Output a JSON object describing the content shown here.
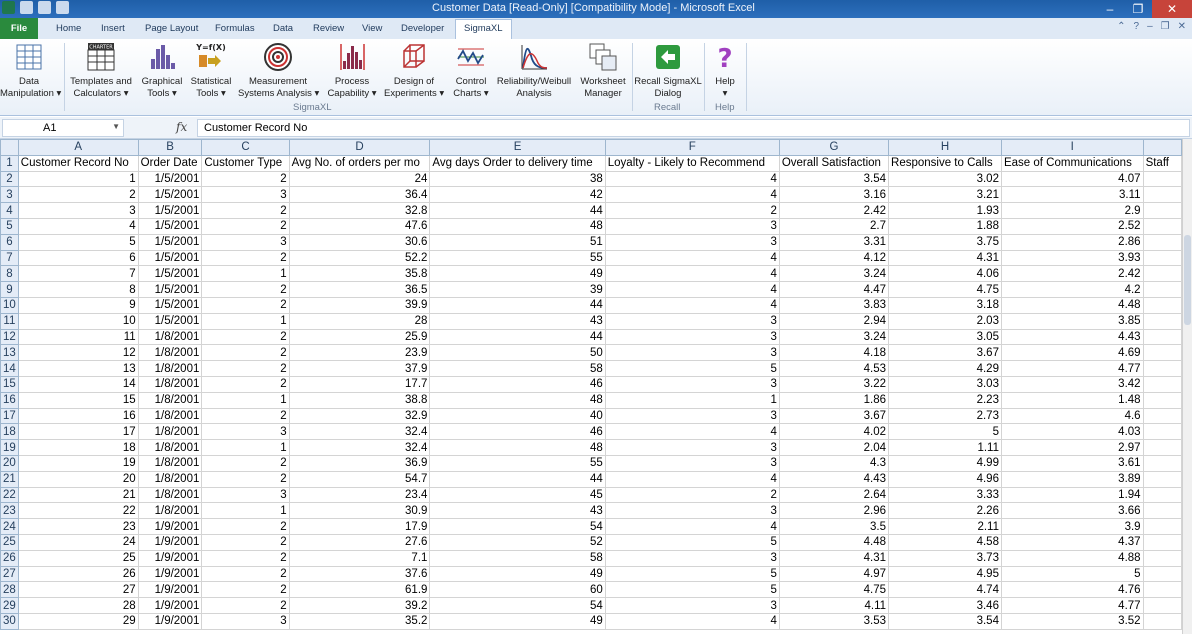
{
  "window": {
    "title": "Customer Data  [Read-Only]  [Compatibility Mode]  -  Microsoft Excel",
    "controls": [
      "–",
      "❐",
      "✕"
    ]
  },
  "ribbon_tabs": {
    "file": "File",
    "tabs": [
      "Home",
      "Insert",
      "Page Layout",
      "Formulas",
      "Data",
      "Review",
      "View",
      "Developer",
      "SigmaXL"
    ],
    "active": "SigmaXL"
  },
  "ribbon": {
    "buttons": [
      {
        "line1": "Data",
        "line2": "Manipulation ▾",
        "icon": "data-manipulation-icon"
      },
      {
        "line1": "Templates and",
        "line2": "Calculators ▾",
        "icon": "templates-icon"
      },
      {
        "line1": "Graphical",
        "line2": "Tools ▾",
        "icon": "graphical-tools-icon"
      },
      {
        "line1": "Statistical",
        "line2": "Tools ▾",
        "icon": "statistical-tools-icon"
      },
      {
        "line1": "Measurement",
        "line2": "Systems Analysis ▾",
        "icon": "target-icon"
      },
      {
        "line1": "Process",
        "line2": "Capability ▾",
        "icon": "capability-icon"
      },
      {
        "line1": "Design of",
        "line2": "Experiments ▾",
        "icon": "cube-icon"
      },
      {
        "line1": "Control",
        "line2": "Charts ▾",
        "icon": "control-chart-icon"
      },
      {
        "line1": "Reliability/Weibull",
        "line2": "Analysis",
        "icon": "weibull-icon"
      },
      {
        "line1": "Worksheet",
        "line2": "Manager",
        "icon": "worksheet-icon"
      },
      {
        "line1": "Recall SigmaXL",
        "line2": "Dialog",
        "icon": "recall-icon"
      },
      {
        "line1": "Help",
        "line2": "▾",
        "icon": "help-icon"
      }
    ],
    "groups": [
      "SigmaXL",
      "Recall",
      "Help"
    ],
    "templates_icon_text": "CHARTER",
    "stat_icon_text": "Y=f(X)"
  },
  "formula_bar": {
    "name_box": "A1",
    "fx": "fx",
    "content": "Customer Record No"
  },
  "sheet": {
    "col_letters": [
      "A",
      "B",
      "C",
      "D",
      "E",
      "F",
      "G",
      "H",
      "I",
      ""
    ],
    "headers": [
      "Customer Record No",
      "Order Date",
      "Customer Type",
      "Avg No. of orders per mo",
      "Avg days Order to delivery time",
      "Loyalty - Likely to Recommend",
      "Overall Satisfaction",
      "Responsive to Calls",
      "Ease of Communications",
      "Staff"
    ],
    "rows": [
      [
        "1",
        "1/5/2001",
        "2",
        "24",
        "38",
        "4",
        "3.54",
        "3.02",
        "4.07",
        ""
      ],
      [
        "2",
        "1/5/2001",
        "3",
        "36.4",
        "42",
        "4",
        "3.16",
        "3.21",
        "3.11",
        ""
      ],
      [
        "3",
        "1/5/2001",
        "2",
        "32.8",
        "44",
        "2",
        "2.42",
        "1.93",
        "2.9",
        ""
      ],
      [
        "4",
        "1/5/2001",
        "2",
        "47.6",
        "48",
        "3",
        "2.7",
        "1.88",
        "2.52",
        ""
      ],
      [
        "5",
        "1/5/2001",
        "3",
        "30.6",
        "51",
        "3",
        "3.31",
        "3.75",
        "2.86",
        ""
      ],
      [
        "6",
        "1/5/2001",
        "2",
        "52.2",
        "55",
        "4",
        "4.12",
        "4.31",
        "3.93",
        ""
      ],
      [
        "7",
        "1/5/2001",
        "1",
        "35.8",
        "49",
        "4",
        "3.24",
        "4.06",
        "2.42",
        ""
      ],
      [
        "8",
        "1/5/2001",
        "2",
        "36.5",
        "39",
        "4",
        "4.47",
        "4.75",
        "4.2",
        ""
      ],
      [
        "9",
        "1/5/2001",
        "2",
        "39.9",
        "44",
        "4",
        "3.83",
        "3.18",
        "4.48",
        ""
      ],
      [
        "10",
        "1/5/2001",
        "1",
        "28",
        "43",
        "3",
        "2.94",
        "2.03",
        "3.85",
        ""
      ],
      [
        "11",
        "1/8/2001",
        "2",
        "25.9",
        "44",
        "3",
        "3.24",
        "3.05",
        "4.43",
        ""
      ],
      [
        "12",
        "1/8/2001",
        "2",
        "23.9",
        "50",
        "3",
        "4.18",
        "3.67",
        "4.69",
        ""
      ],
      [
        "13",
        "1/8/2001",
        "2",
        "37.9",
        "58",
        "5",
        "4.53",
        "4.29",
        "4.77",
        ""
      ],
      [
        "14",
        "1/8/2001",
        "2",
        "17.7",
        "46",
        "3",
        "3.22",
        "3.03",
        "3.42",
        ""
      ],
      [
        "15",
        "1/8/2001",
        "1",
        "38.8",
        "48",
        "1",
        "1.86",
        "2.23",
        "1.48",
        ""
      ],
      [
        "16",
        "1/8/2001",
        "2",
        "32.9",
        "40",
        "3",
        "3.67",
        "2.73",
        "4.6",
        ""
      ],
      [
        "17",
        "1/8/2001",
        "3",
        "32.4",
        "46",
        "4",
        "4.02",
        "5",
        "4.03",
        ""
      ],
      [
        "18",
        "1/8/2001",
        "1",
        "32.4",
        "48",
        "3",
        "2.04",
        "1.11",
        "2.97",
        ""
      ],
      [
        "19",
        "1/8/2001",
        "2",
        "36.9",
        "55",
        "3",
        "4.3",
        "4.99",
        "3.61",
        ""
      ],
      [
        "20",
        "1/8/2001",
        "2",
        "54.7",
        "44",
        "4",
        "4.43",
        "4.96",
        "3.89",
        ""
      ],
      [
        "21",
        "1/8/2001",
        "3",
        "23.4",
        "45",
        "2",
        "2.64",
        "3.33",
        "1.94",
        ""
      ],
      [
        "22",
        "1/8/2001",
        "1",
        "30.9",
        "43",
        "3",
        "2.96",
        "2.26",
        "3.66",
        ""
      ],
      [
        "23",
        "1/9/2001",
        "2",
        "17.9",
        "54",
        "4",
        "3.5",
        "2.11",
        "3.9",
        ""
      ],
      [
        "24",
        "1/9/2001",
        "2",
        "27.6",
        "52",
        "5",
        "4.48",
        "4.58",
        "4.37",
        ""
      ],
      [
        "25",
        "1/9/2001",
        "2",
        "7.1",
        "58",
        "3",
        "4.31",
        "3.73",
        "4.88",
        ""
      ],
      [
        "26",
        "1/9/2001",
        "2",
        "37.6",
        "49",
        "5",
        "4.97",
        "4.95",
        "5",
        ""
      ],
      [
        "27",
        "1/9/2001",
        "2",
        "61.9",
        "60",
        "5",
        "4.75",
        "4.74",
        "4.76",
        ""
      ],
      [
        "28",
        "1/9/2001",
        "2",
        "39.2",
        "54",
        "3",
        "4.11",
        "3.46",
        "4.77",
        ""
      ],
      [
        "29",
        "1/9/2001",
        "3",
        "35.2",
        "49",
        "4",
        "3.53",
        "3.54",
        "3.52",
        ""
      ]
    ]
  }
}
